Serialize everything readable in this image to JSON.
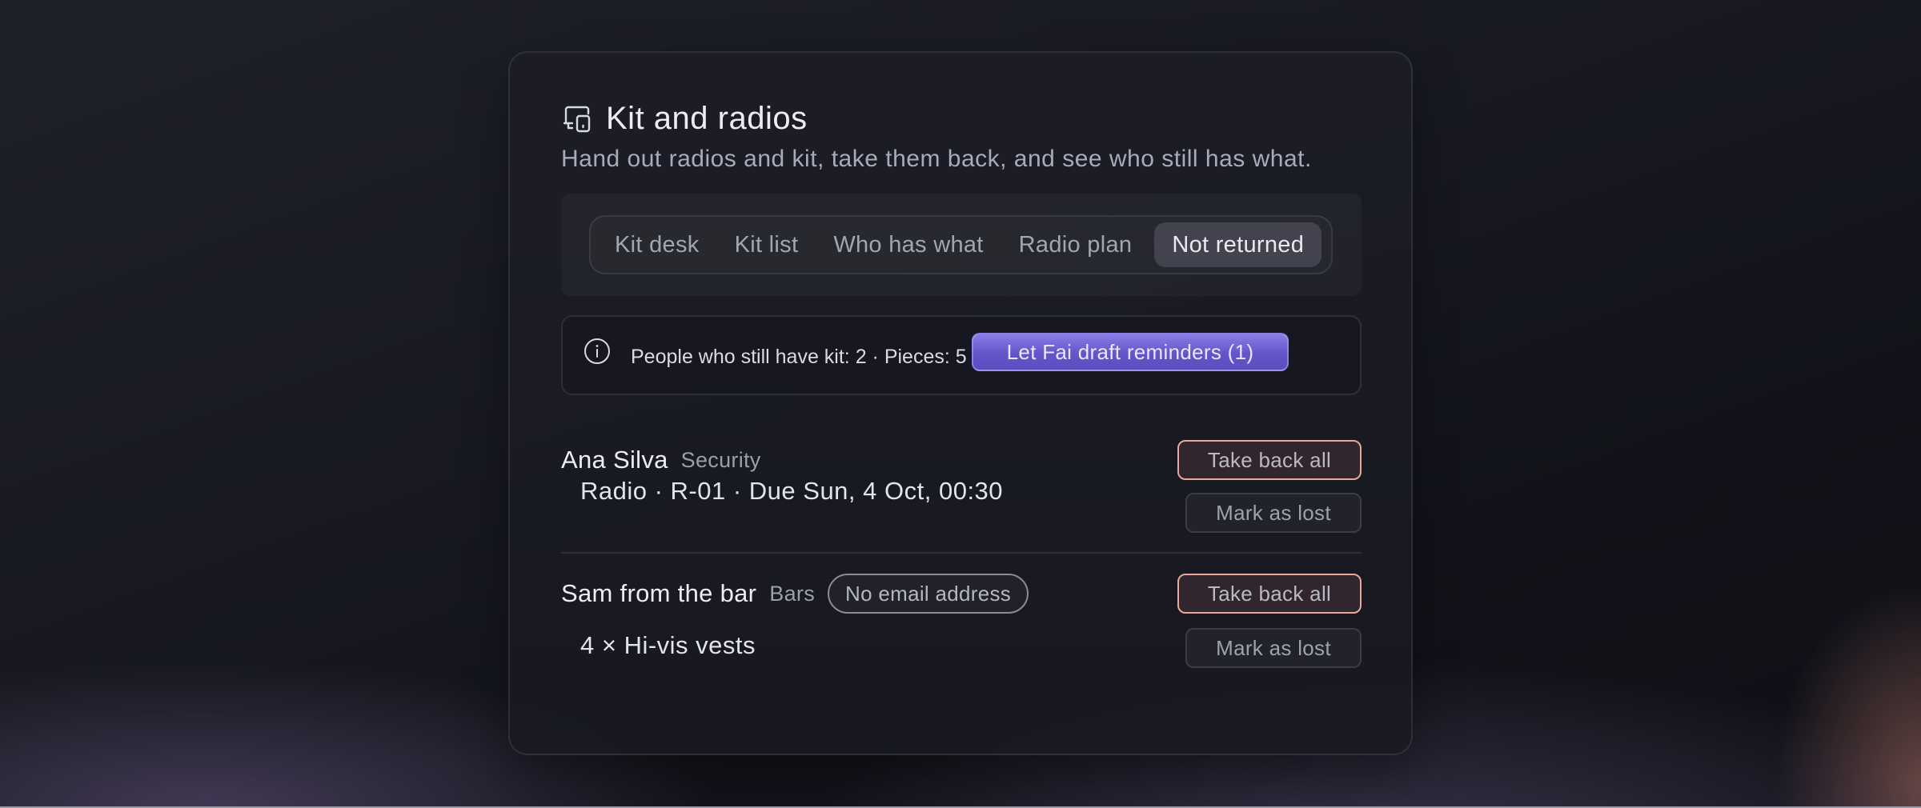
{
  "header": {
    "title": "Kit and radios",
    "title_icon": "devices-icon",
    "subtitle": "Hand out radios and kit, take them back, and see who still has what."
  },
  "tabs": [
    {
      "label": "Kit desk",
      "active": false
    },
    {
      "label": "Kit list",
      "active": false
    },
    {
      "label": "Who has what",
      "active": false
    },
    {
      "label": "Radio plan",
      "active": false
    },
    {
      "label": "Not returned",
      "active": true
    }
  ],
  "summary": {
    "icon": "info-icon",
    "text": "People who still have kit: 2 · Pieces: 5",
    "action_label": "Let Fai draft reminders (1)",
    "action_color": "#6a5dd0"
  },
  "people": [
    {
      "name": "Ana Silva",
      "team": "Security",
      "badge": "",
      "take_back_label": "Take back all",
      "items": [
        {
          "text": "Radio · R-01 · Due Sun, 4 Oct, 00:30",
          "lost_label": "Mark as lost"
        }
      ]
    },
    {
      "name": "Sam from the bar",
      "team": "Bars",
      "badge": "No email address",
      "take_back_label": "Take back all",
      "items": [
        {
          "text": "4 × Hi-vis vests",
          "lost_label": "Mark as lost"
        }
      ]
    }
  ],
  "colors": {
    "take_back_border": "#e8a79a",
    "active_tab_bg": "#43434f"
  }
}
